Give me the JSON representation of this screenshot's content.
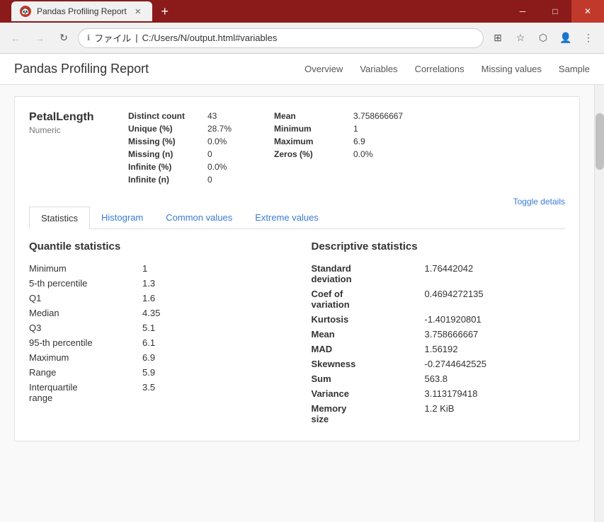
{
  "window": {
    "title": "Pandas Profiling Report",
    "tab_title": "Pandas Profiling Report",
    "close_btn": "✕",
    "minimize_btn": "─",
    "maximize_btn": "□",
    "new_tab_btn": "+"
  },
  "address_bar": {
    "back_btn": "←",
    "forward_btn": "→",
    "refresh_btn": "↻",
    "url_prefix": "ファイル",
    "url": "C:/Users/N/output.html#variables",
    "translate_icon": "⊞",
    "bookmark_icon": "☆",
    "pdf_icon": "📄",
    "account_icon": "👤",
    "menu_icon": "⋮"
  },
  "app_header": {
    "title": "Pandas Profiling Report",
    "nav": [
      "Overview",
      "Variables",
      "Correlations",
      "Missing values",
      "Sample"
    ]
  },
  "variable": {
    "name": "PetalLength",
    "type": "Numeric",
    "stats_left": [
      {
        "label": "Distinct count",
        "value": "43"
      },
      {
        "label": "Unique (%)",
        "value": "28.7%"
      },
      {
        "label": "Missing (%)",
        "value": "0.0%"
      },
      {
        "label": "Missing (n)",
        "value": "0"
      },
      {
        "label": "Infinite (%)",
        "value": "0.0%"
      },
      {
        "label": "Infinite (n)",
        "value": "0"
      }
    ],
    "stats_right": [
      {
        "label": "Mean",
        "value": "3.758666667"
      },
      {
        "label": "Minimum",
        "value": "1"
      },
      {
        "label": "Maximum",
        "value": "6.9"
      },
      {
        "label": "Zeros (%)",
        "value": "0.0%"
      }
    ],
    "toggle_details": "Toggle details"
  },
  "tabs": [
    "Statistics",
    "Histogram",
    "Common values",
    "Extreme values"
  ],
  "active_tab": "Statistics",
  "quantile_stats": {
    "title": "Quantile statistics",
    "rows": [
      {
        "label": "Minimum",
        "value": "1"
      },
      {
        "label": "5-th percentile",
        "value": "1.3"
      },
      {
        "label": "Q1",
        "value": "1.6"
      },
      {
        "label": "Median",
        "value": "4.35"
      },
      {
        "label": "Q3",
        "value": "5.1"
      },
      {
        "label": "95-th percentile",
        "value": "6.1"
      },
      {
        "label": "Maximum",
        "value": "6.9"
      },
      {
        "label": "Range",
        "value": "5.9"
      },
      {
        "label": "Interquartile range",
        "value": "3.5"
      }
    ]
  },
  "descriptive_stats": {
    "title": "Descriptive statistics",
    "rows": [
      {
        "label": "Standard deviation",
        "value": "1.76442042"
      },
      {
        "label": "Coef of variation",
        "value": "0.4694272135"
      },
      {
        "label": "Kurtosis",
        "value": "-1.401920801"
      },
      {
        "label": "Mean",
        "value": "3.758666667"
      },
      {
        "label": "MAD",
        "value": "1.56192"
      },
      {
        "label": "Skewness",
        "value": "-0.2744642525"
      },
      {
        "label": "Sum",
        "value": "563.8"
      },
      {
        "label": "Variance",
        "value": "3.113179418"
      },
      {
        "label": "Memory size",
        "value": "1.2 KiB"
      }
    ]
  },
  "colors": {
    "accent": "#c0392b",
    "link": "#3a7bd5",
    "title_bar": "#8B1A1A"
  }
}
